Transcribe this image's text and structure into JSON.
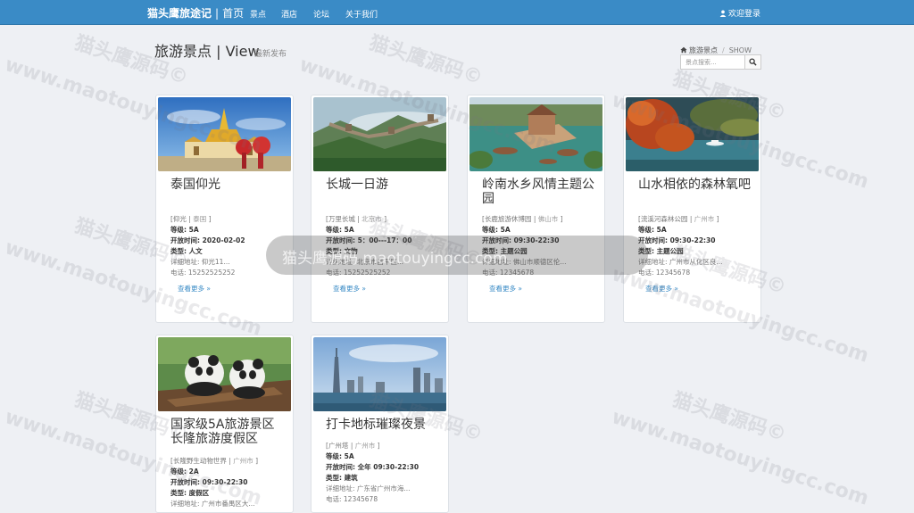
{
  "navbar": {
    "brand": "猫头鹰旅途记",
    "separator": "|",
    "home": "首页",
    "items": [
      {
        "label": "景点"
      },
      {
        "label": "酒店"
      },
      {
        "label": "论坛"
      },
      {
        "label": "关于我们"
      }
    ],
    "login": "欢迎登录",
    "bg_color": "#3a8bc6"
  },
  "header": {
    "title": "旅游景点 | View",
    "subtitle": "最新发布",
    "breadcrumb": {
      "home": "旅游景点",
      "current": "SHOW"
    },
    "search_placeholder": "景点搜索..."
  },
  "cards": [
    {
      "title": "泰国仰光",
      "location": "仰光",
      "region": "泰国",
      "level": "等级: 5A",
      "hours": "开放时间: 2020-02-02",
      "type": "类型: 人文",
      "address": "详细地址: 仰光11...",
      "phone": "电话: 15252525252",
      "more": "查看更多 »"
    },
    {
      "title": "长城一日游",
      "location": "万里长城",
      "region": "北京市",
      "level": "等级: 5A",
      "hours": "开放时间: 5：00---17：00",
      "type": "类型: 文物",
      "address": "详细地址: 北京市昌平区...",
      "phone": "电话: 15252525252",
      "more": "查看更多 »"
    },
    {
      "title": "岭南水乡风情主题公园",
      "location": "长鹿旅游休博园",
      "region": "佛山市",
      "level": "等级: 5A",
      "hours": "开放时间: 09:30-22:30",
      "type": "类型: 主题公园",
      "address": "详细地址: 佛山市顺德区伦...",
      "phone": "电话: 12345678",
      "more": "查看更多 »"
    },
    {
      "title": "山水相依的森林氧吧",
      "location": "流溪河森林公园",
      "region": "广州市",
      "level": "等级: 5A",
      "hours": "开放时间: 09:30-22:30",
      "type": "类型: 主题公园",
      "address": "详细地址: 广州市从化区良...",
      "phone": "电话: 12345678",
      "more": "查看更多 »"
    },
    {
      "title": "国家级5A旅游景区长隆旅游度假区",
      "location": "长隆野生动物世界",
      "region": "广州市",
      "level": "等级: 2A",
      "hours": "开放时间: 09:30-22:30",
      "type": "类型: 度假区",
      "address": "详细地址: 广州市番禺区大...",
      "phone": "",
      "more": "查看更多 »"
    },
    {
      "title": "打卡地标璀璨夜景",
      "location": "广州塔",
      "region": "广州市",
      "level": "等级: 5A",
      "hours": "开放时间: 全年 09:30-22:30",
      "type": "类型: 建筑",
      "address": "详细地址: 广东省广州市海...",
      "phone": "电话: 12345678",
      "more": "查看更多 »"
    }
  ],
  "watermark": {
    "cn": "猫头鹰源码©",
    "en": "www.maotouyingcc.com",
    "overlay": "猫头鹰源码 maotouyingcc.com"
  }
}
